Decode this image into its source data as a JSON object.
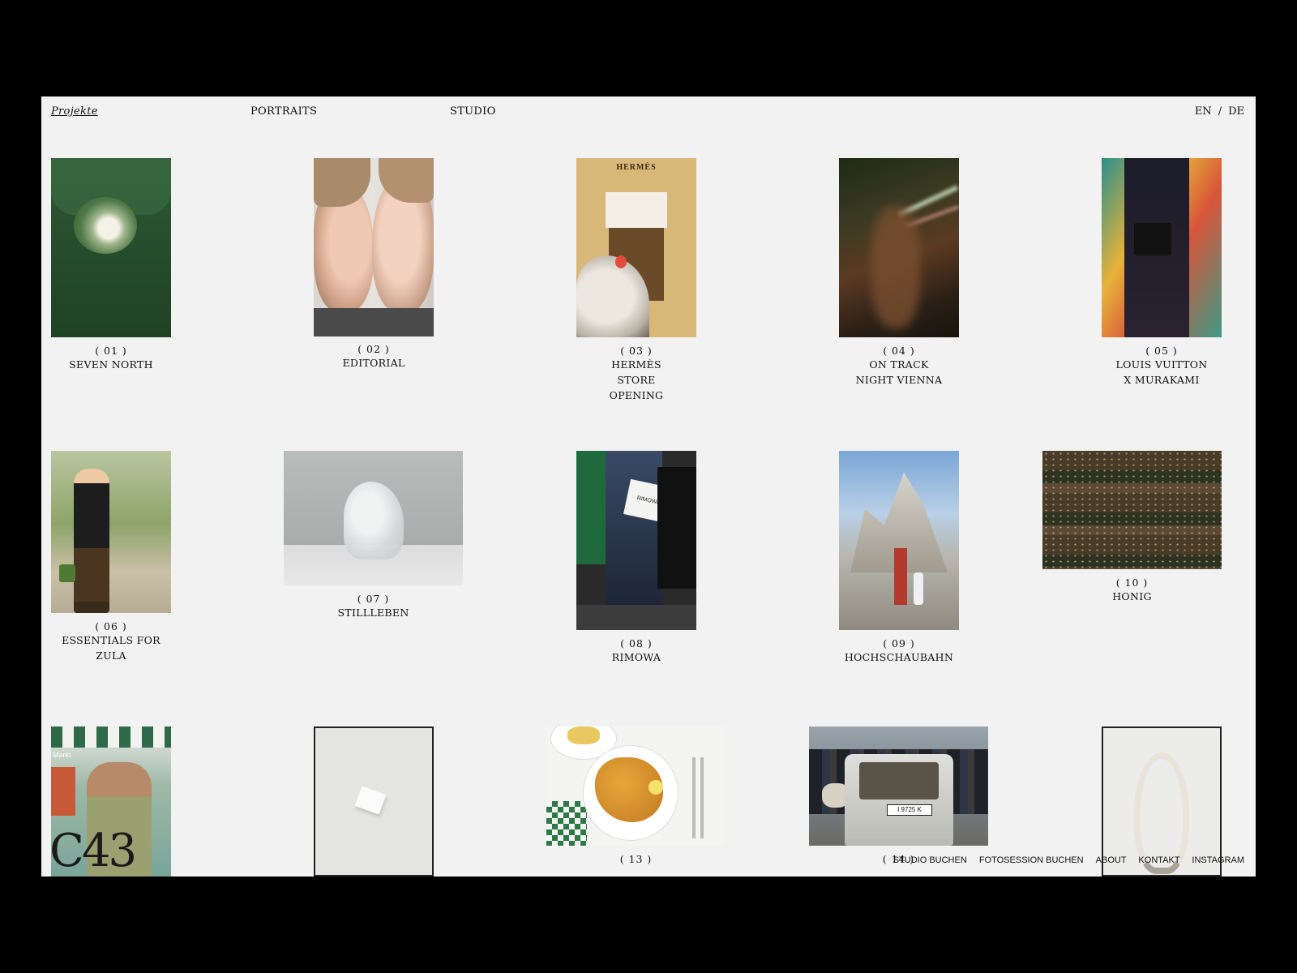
{
  "nav": {
    "projekte": "Projekte",
    "portraits": "PORTRAITS",
    "studio": "STUDIO"
  },
  "lang": {
    "en": "EN",
    "sep": "/",
    "de": "DE"
  },
  "projects": [
    {
      "num": "( 01 )",
      "title": "SEVEN NORTH"
    },
    {
      "num": "( 02 )",
      "title": "EDITORIAL"
    },
    {
      "num": "( 03 )",
      "title": "HERMÈS STORE OPENING"
    },
    {
      "num": "( 04 )",
      "title": "ON TRACK NIGHT VIENNA"
    },
    {
      "num": "( 05 )",
      "title": "LOUIS VUITTON X MURAKAMI"
    },
    {
      "num": "( 06 )",
      "title": "ESSENTIALS FOR ZULA"
    },
    {
      "num": "( 07 )",
      "title": "STILLLEBEN"
    },
    {
      "num": "( 08 )",
      "title": "RIMOWA"
    },
    {
      "num": "( 09 )",
      "title": "HOCHSCHAUBAHN"
    },
    {
      "num": "( 10 )",
      "title": "HONIG"
    },
    {
      "num": "",
      "title": ""
    },
    {
      "num": "",
      "title": ""
    },
    {
      "num": "( 13 )",
      "title": ""
    },
    {
      "num": "( 14 )",
      "title": ""
    },
    {
      "num": "",
      "title": ""
    }
  ],
  "photo_texts": {
    "hermes_sign": "HERMÈS",
    "rimowa_bag": "RIMOWA",
    "market_sign": "Markt",
    "plate": "I 9725 K"
  },
  "footer": {
    "logo": "C43",
    "links": [
      "STUDIO BUCHEN",
      "FOTOSESSION BUCHEN",
      "ABOUT",
      "KONTAKT",
      "INSTAGRAM"
    ]
  },
  "colors": {
    "page_bg": "#f2f2f2",
    "frame": "#000000",
    "text": "#111111"
  }
}
